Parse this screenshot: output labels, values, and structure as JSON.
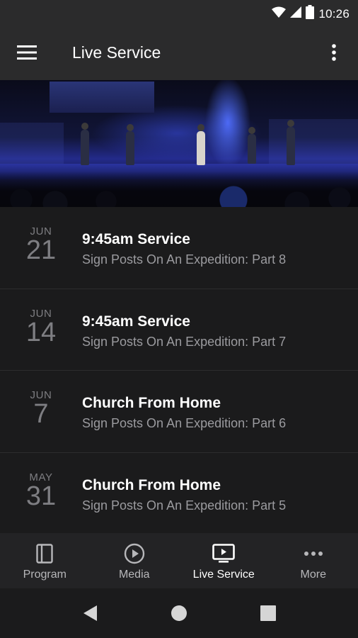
{
  "status_bar": {
    "time": "10:26"
  },
  "app_bar": {
    "title": "Live Service"
  },
  "services": [
    {
      "month": "JUN",
      "day": "21",
      "title": "9:45am Service",
      "subtitle": "Sign Posts On An Expedition: Part 8"
    },
    {
      "month": "JUN",
      "day": "14",
      "title": "9:45am Service",
      "subtitle": "Sign Posts On An Expedition: Part 7"
    },
    {
      "month": "JUN",
      "day": "7",
      "title": "Church From Home",
      "subtitle": "Sign Posts On An Expedition: Part 6"
    },
    {
      "month": "MAY",
      "day": "31",
      "title": "Church From Home",
      "subtitle": "Sign Posts On An Expedition: Part 5"
    }
  ],
  "bottom_nav": [
    {
      "label": "Program",
      "icon": "book-icon",
      "active": false
    },
    {
      "label": "Media",
      "icon": "play-circle-icon",
      "active": false
    },
    {
      "label": "Live Service",
      "icon": "live-tv-icon",
      "active": true
    },
    {
      "label": "More",
      "icon": "more-horizontal-icon",
      "active": false
    }
  ],
  "colors": {
    "background": "#1b1b1c",
    "app_bar": "#2b2b2c",
    "nav_bar": "#232325"
  }
}
